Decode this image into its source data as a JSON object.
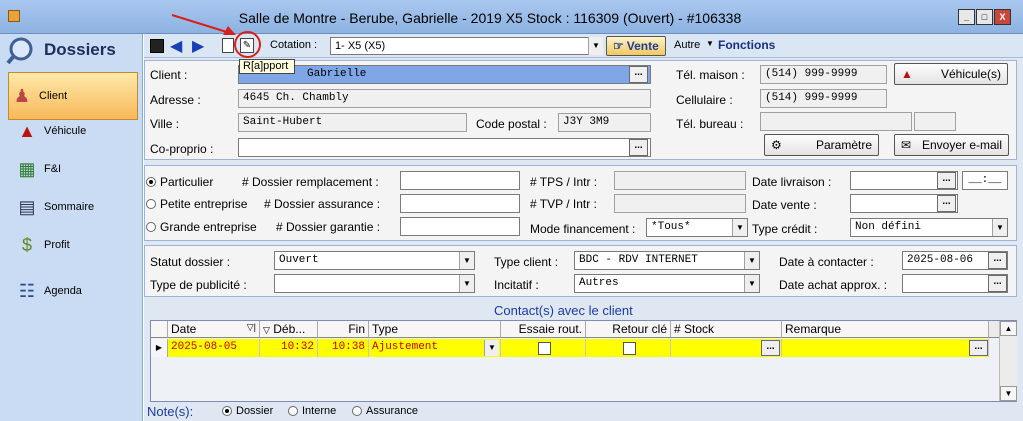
{
  "window": {
    "title": "Salle de Montre - Berube, Gabrielle - 2019 X5 Stock : 116309 (Ouvert) - #106338",
    "minimize": "_",
    "maximize": "□",
    "close": "X"
  },
  "sidebar": {
    "header": "Dossiers",
    "items": [
      {
        "label": "Client",
        "icon": "people-icon"
      },
      {
        "label": "Véhicule",
        "icon": "car-icon"
      },
      {
        "label": "F&I",
        "icon": "finance-icon"
      },
      {
        "label": "Sommaire",
        "icon": "document-icon"
      },
      {
        "label": "Profit",
        "icon": "money-icon"
      },
      {
        "label": "Agenda",
        "icon": "book-icon"
      }
    ]
  },
  "toolbar": {
    "cotation_label": "Cotation :",
    "cotation_value": "1- X5 (X5)",
    "vente_label": "Vente",
    "autre_label": "Autre",
    "fonctions_label": "Fonctions",
    "tooltip": "R[a]pport"
  },
  "client": {
    "client_label": "Client :",
    "client_value": "Gabrielle",
    "adresse_label": "Adresse :",
    "adresse_value": "4645 Ch. Chambly",
    "ville_label": "Ville :",
    "ville_value": "Saint-Hubert",
    "code_postal_label": "Code postal :",
    "code_postal_value": "J3Y 3M9",
    "coproprio_label": "Co-proprio :",
    "tel_maison_label": "Tél. maison :",
    "tel_maison_value": "(514) 999-9999",
    "cellulaire_label": "Cellulaire :",
    "cellulaire_value": "(514) 999-9999",
    "tel_bureau_label": "Tél. bureau :",
    "vehicules_btn": "Véhicule(s)",
    "parametre_btn": "Paramètre",
    "email_btn": "Envoyer e-mail"
  },
  "dossier": {
    "particulier": "Particulier",
    "petite_entreprise": "Petite entreprise",
    "grande_entreprise": "Grande entreprise",
    "remplacement_label": "# Dossier remplacement :",
    "assurance_label": "# Dossier assurance :",
    "garantie_label": "# Dossier garantie :",
    "tps_label": "# TPS / Intr :",
    "tvp_label": "# TVP / Intr :",
    "mode_financement_label": "Mode financement :",
    "mode_financement_value": "*Tous*",
    "date_livraison_label": "Date livraison :",
    "date_livraison_time": "__:__",
    "date_vente_label": "Date vente :",
    "type_credit_label": "Type crédit :",
    "type_credit_value": "Non défini"
  },
  "statut": {
    "statut_label": "Statut dossier :",
    "statut_value": "Ouvert",
    "publicite_label": "Type de publicité :",
    "type_client_label": "Type client :",
    "type_client_value": "BDC - RDV INTERNET",
    "incitatif_label": "Incitatif :",
    "incitatif_value": "Autres",
    "date_contacter_label": "Date à contacter :",
    "date_contacter_value": "2025-08-06",
    "date_achat_label": "Date achat approx. :"
  },
  "contacts": {
    "title": "Contact(s) avec le client",
    "columns": [
      "Date",
      "Déb...",
      "Fin",
      "Type",
      "Essaie rout.",
      "Retour clé",
      "# Stock",
      "Remarque"
    ],
    "rows": [
      {
        "date": "2025-08-05",
        "debut": "10:32",
        "fin": "10:38",
        "type": "Ajustement"
      }
    ]
  },
  "notes": {
    "label": "Note(s):",
    "options": [
      "Dossier",
      "Interne",
      "Assurance"
    ]
  }
}
